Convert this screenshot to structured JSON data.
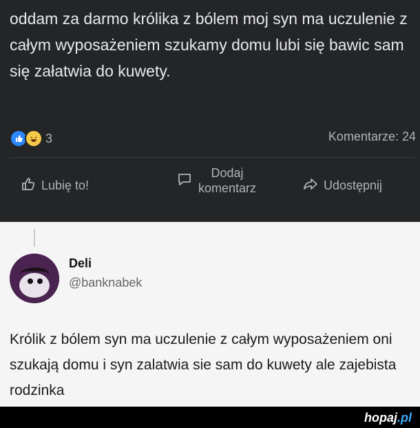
{
  "post": {
    "text": "oddam za darmo królika z bólem moj syn ma uczulenie z całym wyposażeniem szukamy domu lubi się bawic sam się załatwia do kuwety.",
    "reaction_count": "3",
    "comments_label": "Komentarze: 24",
    "actions": {
      "like": "Lubię to!",
      "comment_line1": "Dodaj",
      "comment_line2": "komentarz",
      "share": "Udostępnij"
    }
  },
  "tweet": {
    "display_name": "Deli",
    "handle": "@banknabek",
    "text": "Królik z bólem syn ma uczulenie z całym wyposażeniem oni szukają domu i syn zalatwia sie sam do kuwety ale zajebista rodzinka"
  },
  "watermark": {
    "name": "hopaj",
    "tld": ".pl"
  },
  "colors": {
    "fb_background": "#242526",
    "tweet_background": "#f5f5f5",
    "like_blue": "#2d88ff",
    "brand_blue": "#3fa9f5"
  }
}
